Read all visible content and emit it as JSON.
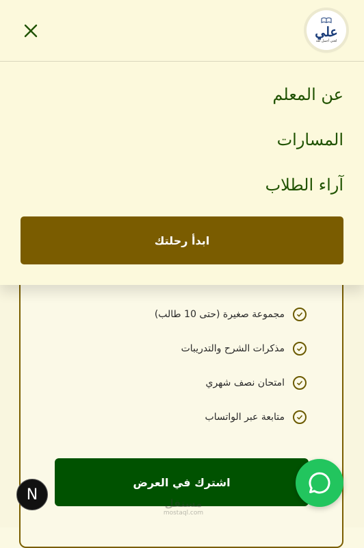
{
  "header": {
    "logo": {
      "icon": "book-icon",
      "name": "علي",
      "tagline": "لغتي أجمل لغة"
    },
    "close_icon": "close-icon"
  },
  "menu": {
    "items": [
      {
        "label": "عن المعلم"
      },
      {
        "label": "المسارات"
      },
      {
        "label": "آراء الطلاب"
      }
    ],
    "cta_label": "ابدأ رحلتك"
  },
  "plan": {
    "features": [
      {
        "icon": "check-circle-icon",
        "label": "مجموعة صغيرة (حتى 10 طالب)"
      },
      {
        "icon": "check-circle-icon",
        "label": "مذكرات الشرح والتدريبات"
      },
      {
        "icon": "check-circle-icon",
        "label": "امتحان نصف شهري"
      },
      {
        "icon": "check-circle-icon",
        "label": "متابعة عبر الواتساب"
      }
    ],
    "subscribe_label": "اشترك في العرض"
  },
  "watermark": {
    "text": "مستقل",
    "sub": "mostaql.com"
  },
  "next_badge": {
    "label": "N"
  },
  "whatsapp": {
    "icon": "whatsapp-chat-icon"
  },
  "colors": {
    "primary_green": "#005200",
    "gold": "#7a5c00",
    "menu_bg": "#fcf9dc",
    "whatsapp_green": "#22c55e"
  }
}
